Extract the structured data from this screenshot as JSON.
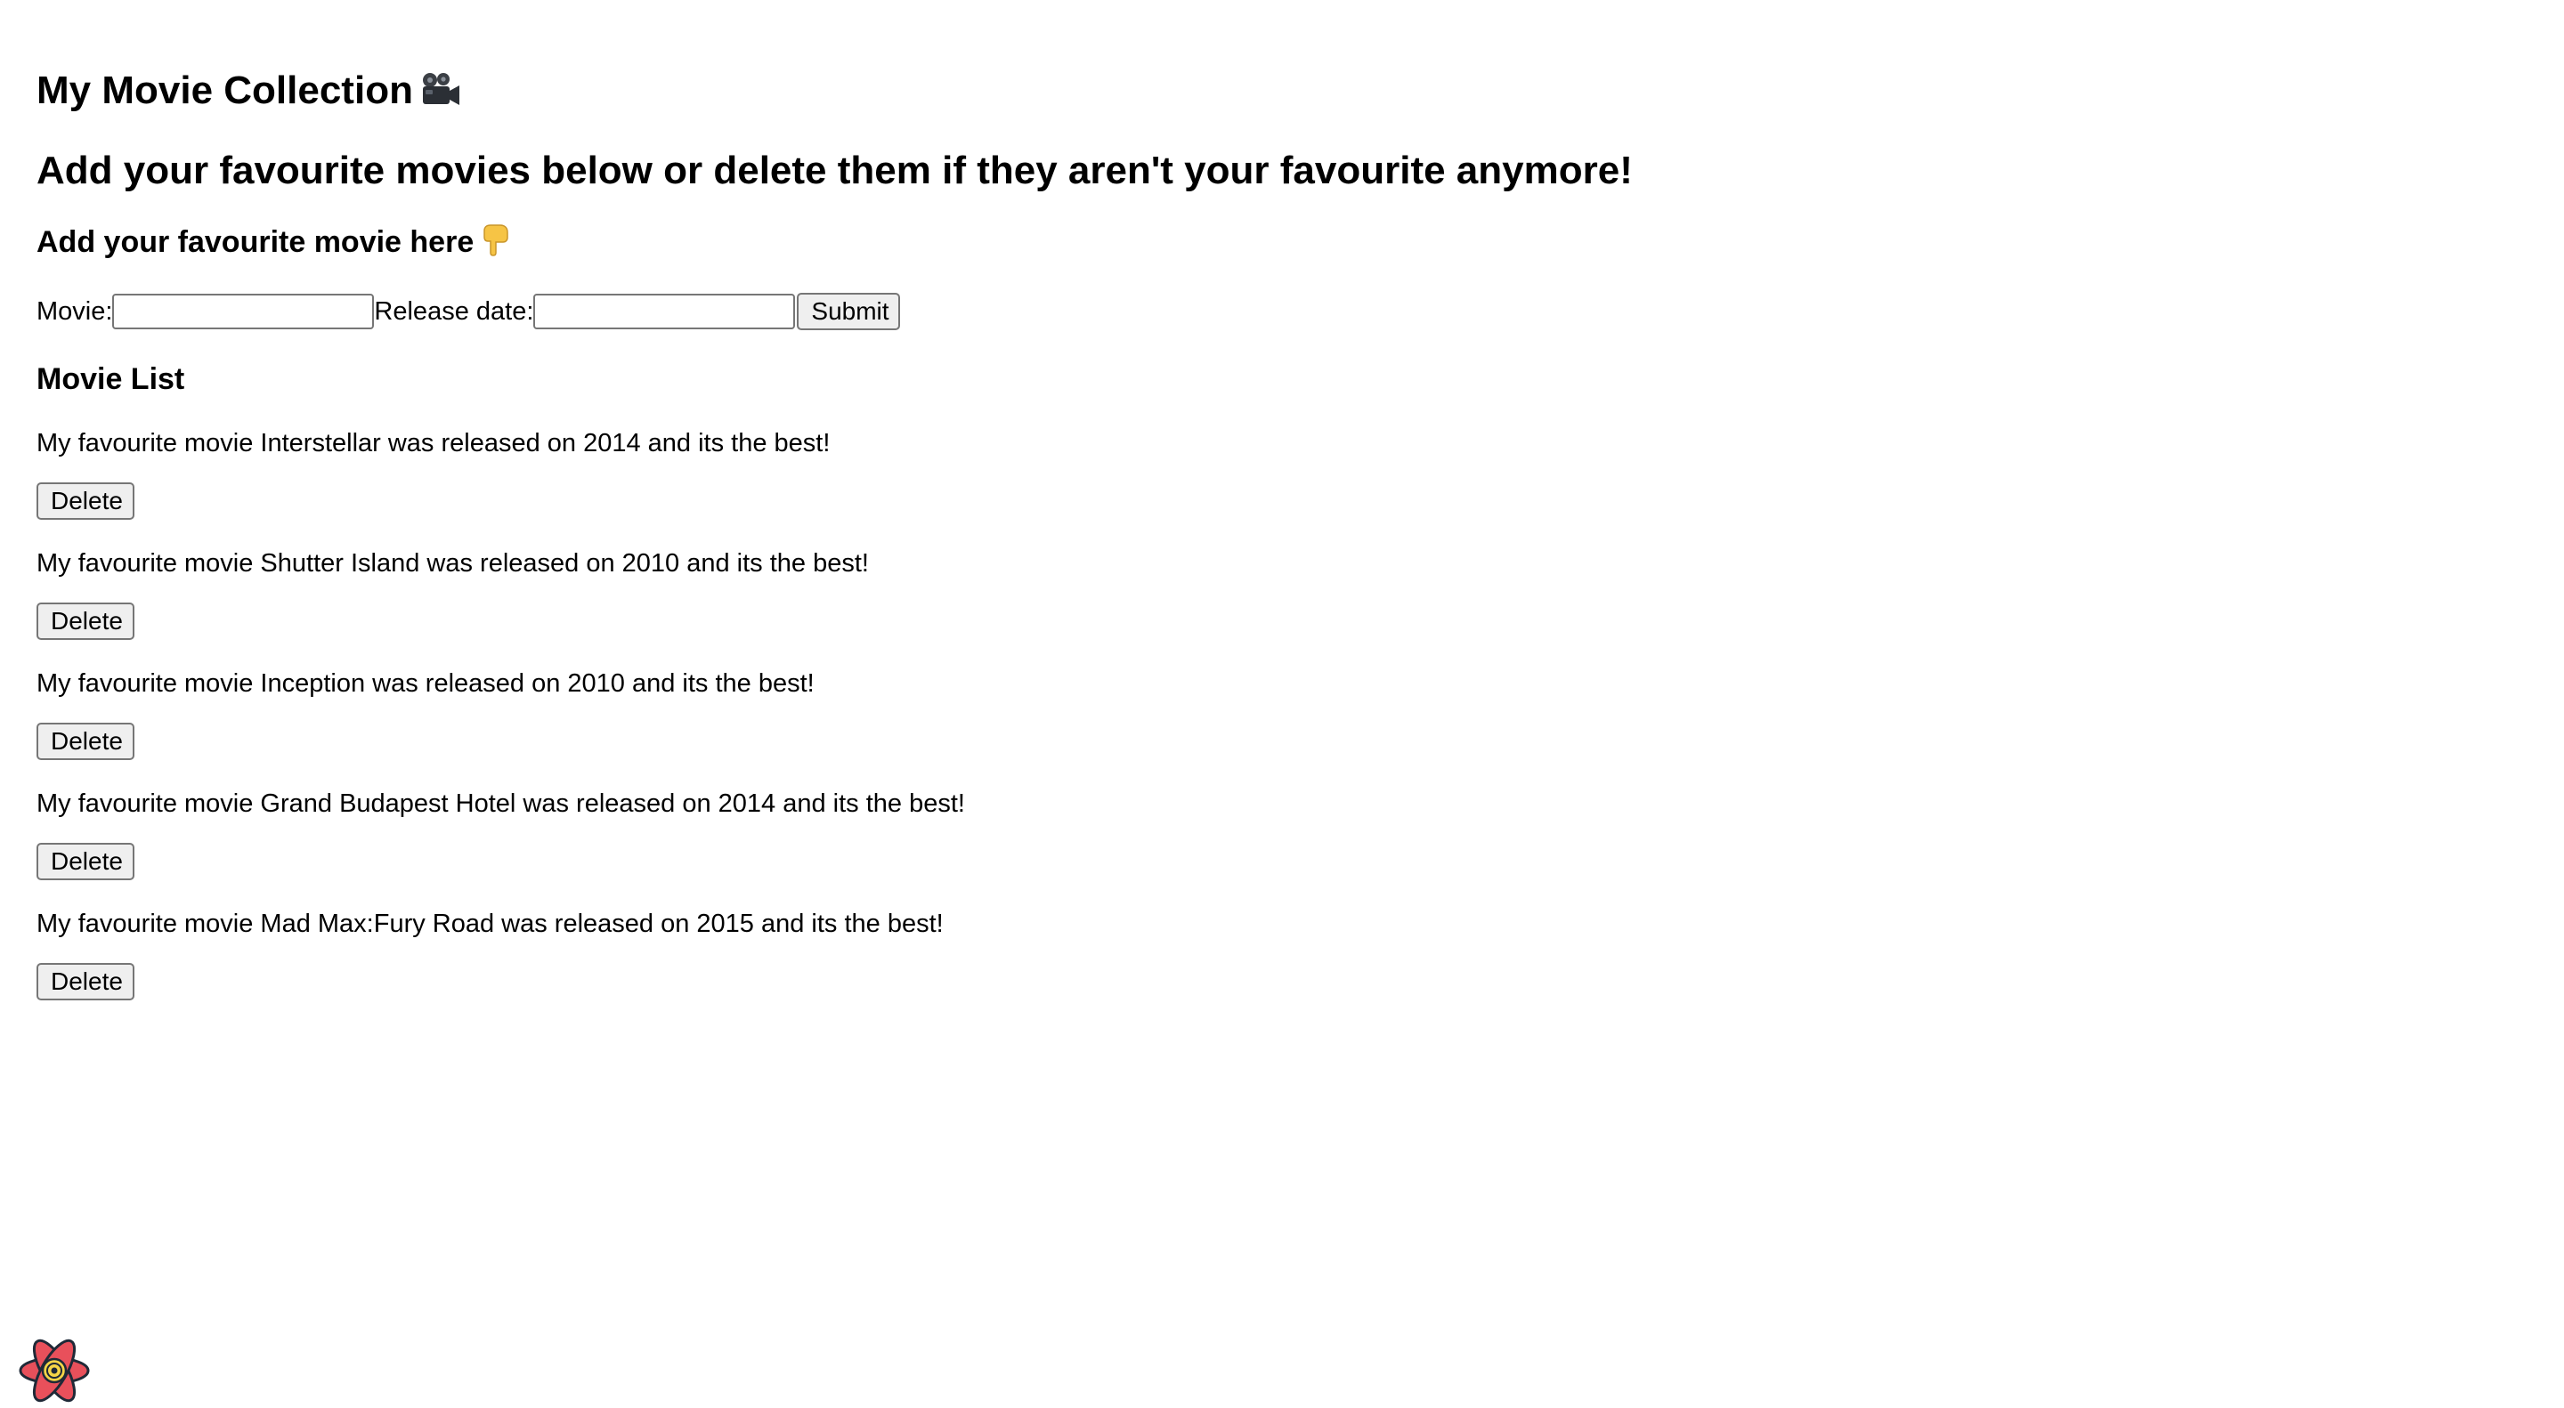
{
  "header": {
    "title": "My Movie Collection",
    "title_icon": "movie-camera-icon",
    "subtitle": "Add your favourite movies below or delete them if they aren't your favourite anymore!"
  },
  "form": {
    "heading": "Add your favourite movie here",
    "heading_icon": "pointing-down-hand-icon",
    "movie_label": "Movie:",
    "movie_value": "",
    "release_label": "Release date:",
    "release_value": "",
    "submit_label": "Submit"
  },
  "list": {
    "heading": "Movie List",
    "delete_label": "Delete",
    "items": [
      {
        "text": "My favourite movie Interstellar was released on 2014 and its the best!"
      },
      {
        "text": "My favourite movie Shutter Island was released on 2010 and its the best!"
      },
      {
        "text": "My favourite movie Inception was released on 2010 and its the best!"
      },
      {
        "text": "My favourite movie Grand Budapest Hotel was released on 2014 and its the best!"
      },
      {
        "text": "My favourite movie Mad Max:Fury Road was released on 2015 and its the best!"
      }
    ]
  },
  "devtools": {
    "icon": "react-query-devtools-logo-icon",
    "colors": {
      "petal": "#e8505b",
      "center": "#f5d547",
      "outline": "#1f2937"
    }
  }
}
